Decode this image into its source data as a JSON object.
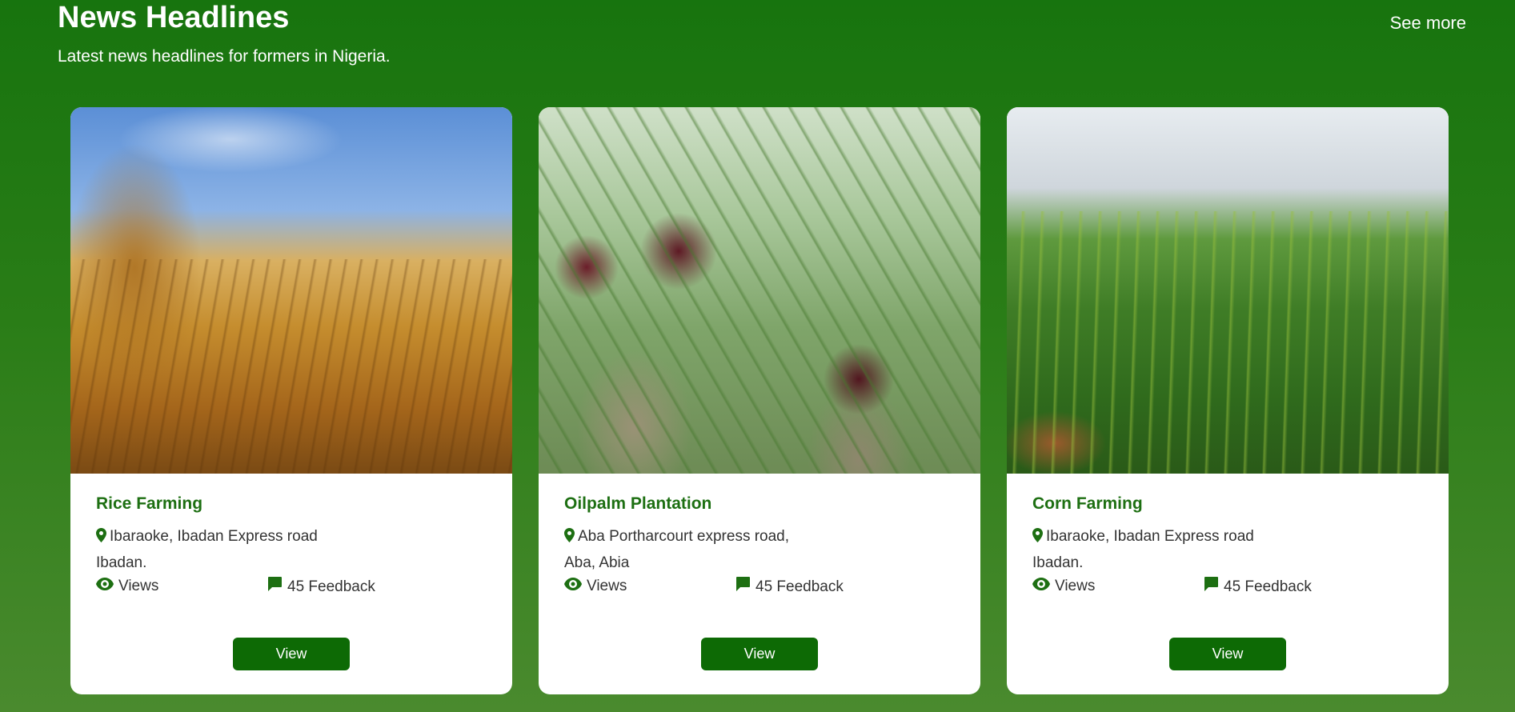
{
  "header": {
    "title": "News Headlines",
    "subtitle": "Latest news headlines for formers in Nigeria.",
    "see_more": "See more"
  },
  "colors": {
    "background_top": "#17740e",
    "background_bottom": "#4a8a2e",
    "accent_green": "#1d6f12",
    "button_green": "#0d6a05"
  },
  "cards": [
    {
      "title": "Rice Farming",
      "location_line1": "Ibaraoke, Ibadan Express road",
      "location_line2": "Ibadan.",
      "views_label": "Views",
      "feedback_label": "45 Feedback",
      "button_label": "View",
      "image": "wheat-field-photo"
    },
    {
      "title": "Oilpalm Plantation",
      "location_line1": "Aba Portharcourt express road,",
      "location_line2": "Aba, Abia",
      "views_label": "Views",
      "feedback_label": "45 Feedback",
      "button_label": "View",
      "image": "oil-palm-photo"
    },
    {
      "title": "Corn Farming",
      "location_line1": "Ibaraoke, Ibadan Express road",
      "location_line2": "Ibadan.",
      "views_label": "Views",
      "feedback_label": "45 Feedback",
      "button_label": "View",
      "image": "corn-field-photo"
    }
  ],
  "icons": {
    "location": "map-pin-icon",
    "views": "eye-icon",
    "feedback": "comment-icon"
  }
}
